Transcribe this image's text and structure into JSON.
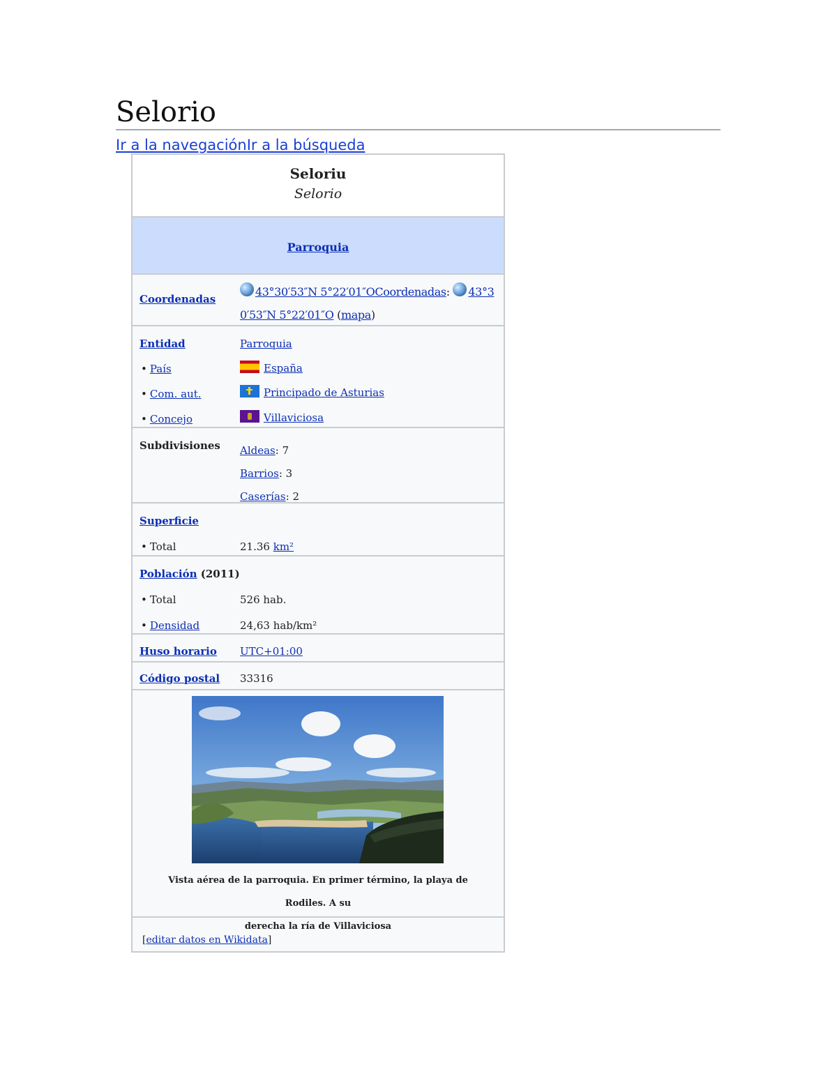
{
  "page": {
    "title": "Selorio",
    "jump_nav": "Ir a la navegación",
    "jump_search": "Ir a la búsqueda"
  },
  "infobox": {
    "name": "Seloriu",
    "alt_name": "Selorio",
    "type": "Parroquia",
    "coords": {
      "label": "Coordenadas",
      "value_line1a": "43°30′53″N 5°22′01″O",
      "value_line1b": "Coordenadas",
      "value_line1c": "43°3",
      "value_line2a": "0′53″N 5°22′01″O",
      "map_link": "mapa"
    },
    "entity": {
      "label": "Entidad",
      "value": "Parroquia",
      "country_label": "País",
      "country": "España",
      "region_label": "Com. aut.",
      "region": "Principado de Asturias",
      "council_label": "Concejo",
      "council": "Villaviciosa"
    },
    "subdivisions": {
      "label": "Subdivisiones",
      "items": [
        {
          "name": "Aldeas",
          "count": "7"
        },
        {
          "name": "Barrios",
          "count": "3"
        },
        {
          "name": "Caserías",
          "count": "2"
        }
      ]
    },
    "area": {
      "label": "Superficie",
      "total_label": "Total",
      "total": "21.36",
      "unit": "km²"
    },
    "population": {
      "label": "Población",
      "year": "(2011)",
      "total_label": "Total",
      "total": "526 hab.",
      "density_label": "Densidad",
      "density": "24,63 hab/km²"
    },
    "timezone": {
      "label": "Huso horario",
      "value": "UTC+01:00"
    },
    "postal": {
      "label": "Código postal",
      "value": "33316"
    },
    "image": {
      "caption_line1": "Vista aérea de la parroquia. En primer término, la playa de Rodiles. A su",
      "caption_line2": "derecha la ría de Villaviciosa"
    },
    "edit_link": "editar datos en Wikidata"
  },
  "colors": {
    "link": "#0b2fb5",
    "header_band": "#ccdcfc",
    "border": "#c8ccd1"
  }
}
